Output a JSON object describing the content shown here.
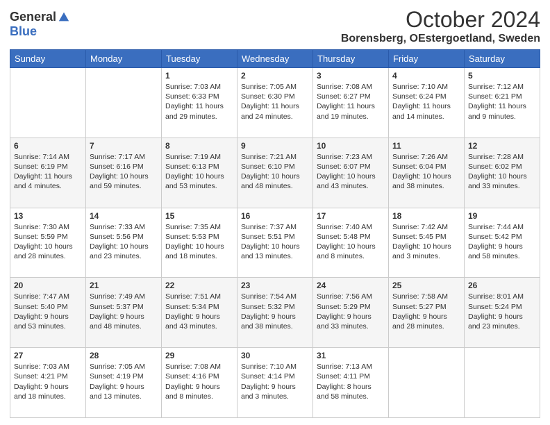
{
  "logo": {
    "general": "General",
    "blue": "Blue"
  },
  "header": {
    "month": "October 2024",
    "location": "Borensberg, OEstergoetland, Sweden"
  },
  "weekdays": [
    "Sunday",
    "Monday",
    "Tuesday",
    "Wednesday",
    "Thursday",
    "Friday",
    "Saturday"
  ],
  "weeks": [
    [
      {
        "day": "",
        "content": ""
      },
      {
        "day": "",
        "content": ""
      },
      {
        "day": "1",
        "content": "Sunrise: 7:03 AM\nSunset: 6:33 PM\nDaylight: 11 hours and 29 minutes."
      },
      {
        "day": "2",
        "content": "Sunrise: 7:05 AM\nSunset: 6:30 PM\nDaylight: 11 hours and 24 minutes."
      },
      {
        "day": "3",
        "content": "Sunrise: 7:08 AM\nSunset: 6:27 PM\nDaylight: 11 hours and 19 minutes."
      },
      {
        "day": "4",
        "content": "Sunrise: 7:10 AM\nSunset: 6:24 PM\nDaylight: 11 hours and 14 minutes."
      },
      {
        "day": "5",
        "content": "Sunrise: 7:12 AM\nSunset: 6:21 PM\nDaylight: 11 hours and 9 minutes."
      }
    ],
    [
      {
        "day": "6",
        "content": "Sunrise: 7:14 AM\nSunset: 6:19 PM\nDaylight: 11 hours and 4 minutes."
      },
      {
        "day": "7",
        "content": "Sunrise: 7:17 AM\nSunset: 6:16 PM\nDaylight: 10 hours and 59 minutes."
      },
      {
        "day": "8",
        "content": "Sunrise: 7:19 AM\nSunset: 6:13 PM\nDaylight: 10 hours and 53 minutes."
      },
      {
        "day": "9",
        "content": "Sunrise: 7:21 AM\nSunset: 6:10 PM\nDaylight: 10 hours and 48 minutes."
      },
      {
        "day": "10",
        "content": "Sunrise: 7:23 AM\nSunset: 6:07 PM\nDaylight: 10 hours and 43 minutes."
      },
      {
        "day": "11",
        "content": "Sunrise: 7:26 AM\nSunset: 6:04 PM\nDaylight: 10 hours and 38 minutes."
      },
      {
        "day": "12",
        "content": "Sunrise: 7:28 AM\nSunset: 6:02 PM\nDaylight: 10 hours and 33 minutes."
      }
    ],
    [
      {
        "day": "13",
        "content": "Sunrise: 7:30 AM\nSunset: 5:59 PM\nDaylight: 10 hours and 28 minutes."
      },
      {
        "day": "14",
        "content": "Sunrise: 7:33 AM\nSunset: 5:56 PM\nDaylight: 10 hours and 23 minutes."
      },
      {
        "day": "15",
        "content": "Sunrise: 7:35 AM\nSunset: 5:53 PM\nDaylight: 10 hours and 18 minutes."
      },
      {
        "day": "16",
        "content": "Sunrise: 7:37 AM\nSunset: 5:51 PM\nDaylight: 10 hours and 13 minutes."
      },
      {
        "day": "17",
        "content": "Sunrise: 7:40 AM\nSunset: 5:48 PM\nDaylight: 10 hours and 8 minutes."
      },
      {
        "day": "18",
        "content": "Sunrise: 7:42 AM\nSunset: 5:45 PM\nDaylight: 10 hours and 3 minutes."
      },
      {
        "day": "19",
        "content": "Sunrise: 7:44 AM\nSunset: 5:42 PM\nDaylight: 9 hours and 58 minutes."
      }
    ],
    [
      {
        "day": "20",
        "content": "Sunrise: 7:47 AM\nSunset: 5:40 PM\nDaylight: 9 hours and 53 minutes."
      },
      {
        "day": "21",
        "content": "Sunrise: 7:49 AM\nSunset: 5:37 PM\nDaylight: 9 hours and 48 minutes."
      },
      {
        "day": "22",
        "content": "Sunrise: 7:51 AM\nSunset: 5:34 PM\nDaylight: 9 hours and 43 minutes."
      },
      {
        "day": "23",
        "content": "Sunrise: 7:54 AM\nSunset: 5:32 PM\nDaylight: 9 hours and 38 minutes."
      },
      {
        "day": "24",
        "content": "Sunrise: 7:56 AM\nSunset: 5:29 PM\nDaylight: 9 hours and 33 minutes."
      },
      {
        "day": "25",
        "content": "Sunrise: 7:58 AM\nSunset: 5:27 PM\nDaylight: 9 hours and 28 minutes."
      },
      {
        "day": "26",
        "content": "Sunrise: 8:01 AM\nSunset: 5:24 PM\nDaylight: 9 hours and 23 minutes."
      }
    ],
    [
      {
        "day": "27",
        "content": "Sunrise: 7:03 AM\nSunset: 4:21 PM\nDaylight: 9 hours and 18 minutes."
      },
      {
        "day": "28",
        "content": "Sunrise: 7:05 AM\nSunset: 4:19 PM\nDaylight: 9 hours and 13 minutes."
      },
      {
        "day": "29",
        "content": "Sunrise: 7:08 AM\nSunset: 4:16 PM\nDaylight: 9 hours and 8 minutes."
      },
      {
        "day": "30",
        "content": "Sunrise: 7:10 AM\nSunset: 4:14 PM\nDaylight: 9 hours and 3 minutes."
      },
      {
        "day": "31",
        "content": "Sunrise: 7:13 AM\nSunset: 4:11 PM\nDaylight: 8 hours and 58 minutes."
      },
      {
        "day": "",
        "content": ""
      },
      {
        "day": "",
        "content": ""
      }
    ]
  ]
}
